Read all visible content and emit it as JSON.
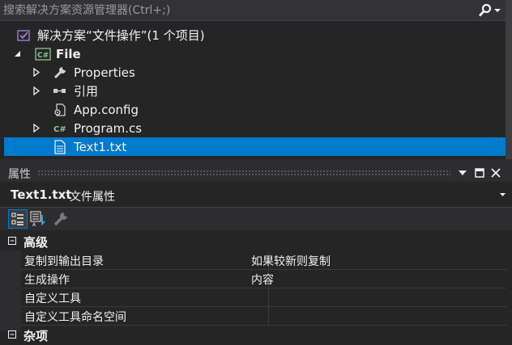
{
  "search": {
    "placeholder": "搜索解决方案资源管理器(Ctrl+;)"
  },
  "tree": {
    "solution": "解决方案“文件操作”(1 个项目)",
    "project": "File",
    "items": [
      {
        "label": "Properties",
        "icon": "wrench-icon"
      },
      {
        "label": "引用",
        "icon": "references-icon"
      },
      {
        "label": "App.config",
        "icon": "config-file-icon"
      },
      {
        "label": "Program.cs",
        "icon": "csharp-file-icon"
      },
      {
        "label": "Text1.txt",
        "icon": "text-file-icon"
      }
    ],
    "csharp_glyph": "C#"
  },
  "properties": {
    "title": "属性",
    "object_name": "Text1.txt",
    "object_type": "文件属性",
    "category": "高级",
    "category2": "杂项",
    "rows": [
      {
        "name": "复制到输出目录",
        "value": "如果较新则复制"
      },
      {
        "name": "生成操作",
        "value": "内容"
      },
      {
        "name": "自定义工具",
        "value": ""
      },
      {
        "name": "自定义工具命名空间",
        "value": ""
      }
    ]
  },
  "colors": {
    "accent": "#007acc",
    "background": "#252526",
    "panel": "#2d2d30"
  }
}
